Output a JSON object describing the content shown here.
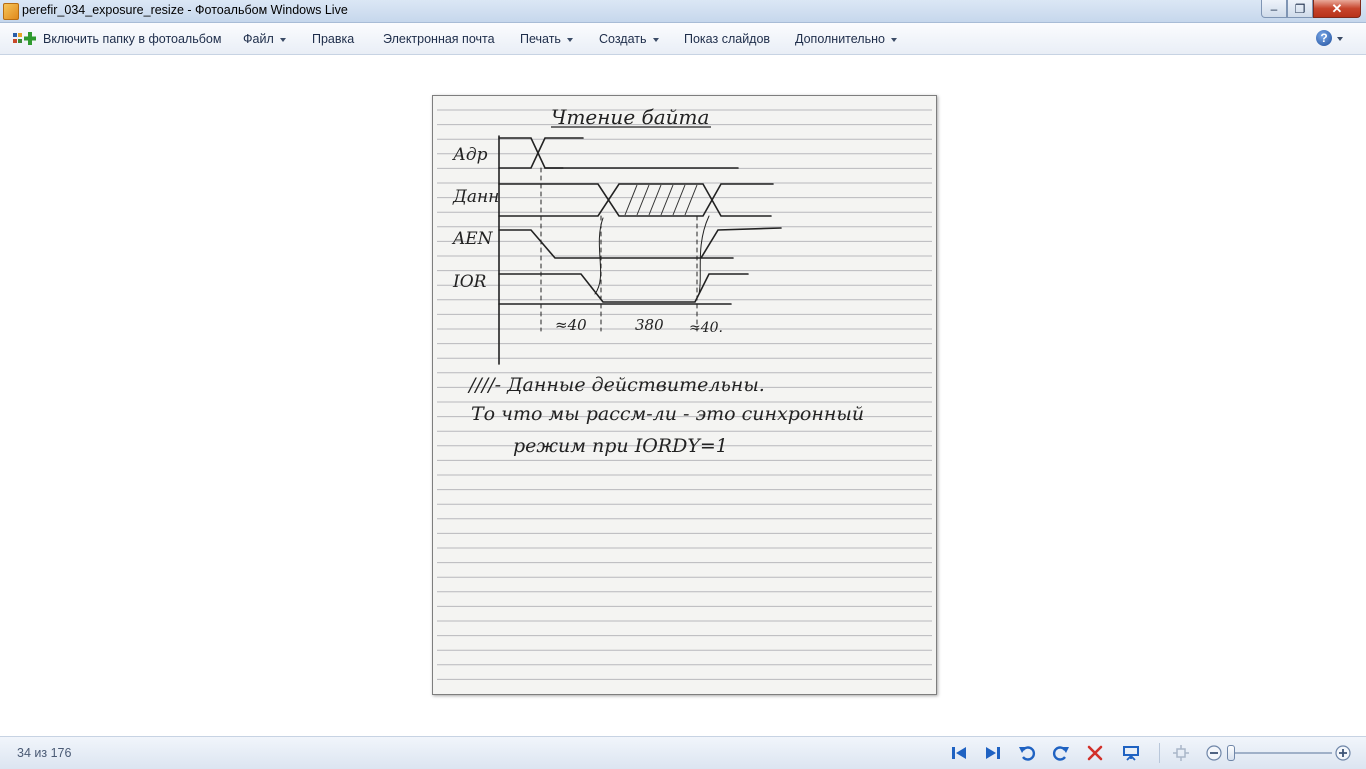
{
  "window": {
    "title": "perefir_034_exposure_resize - Фотоальбом Windows Live",
    "minimize_glyph": "–",
    "maximize_glyph": "❐",
    "close_glyph": "✕"
  },
  "commandbar": {
    "items": [
      {
        "label": "Включить папку в фотоальбом"
      },
      {
        "label": "Файл",
        "dropdown": true
      },
      {
        "label": "Правка"
      },
      {
        "label": "Электронная почта"
      },
      {
        "label": "Печать",
        "dropdown": true
      },
      {
        "label": "Создать",
        "dropdown": true
      },
      {
        "label": "Показ слайдов"
      },
      {
        "label": "Дополнительно",
        "dropdown": true
      }
    ],
    "help_glyph": "?"
  },
  "photo": {
    "description_icon": "handwritten-notebook-page",
    "handwriting": {
      "title": "Чтение байта",
      "signal_addr": "Адр",
      "signal_data": "Данн",
      "signal_aen": "AEN",
      "signal_ior": "IOR",
      "t1": "≈40",
      "t2": "380",
      "t3": "≈40.",
      "note1": "////- Данные действительны.",
      "note2": "То что мы рассм-ли - это синхронный",
      "note3": "режим при IORDY=1"
    }
  },
  "statusbar": {
    "counter": "34 из 176",
    "icons": [
      "first-photo-icon",
      "next-photo-icon",
      "rotate-left-icon",
      "rotate-right-icon",
      "delete-icon",
      "slideshow-icon",
      "fit-icon",
      "zoom-out-icon",
      "zoom-in-icon"
    ]
  }
}
